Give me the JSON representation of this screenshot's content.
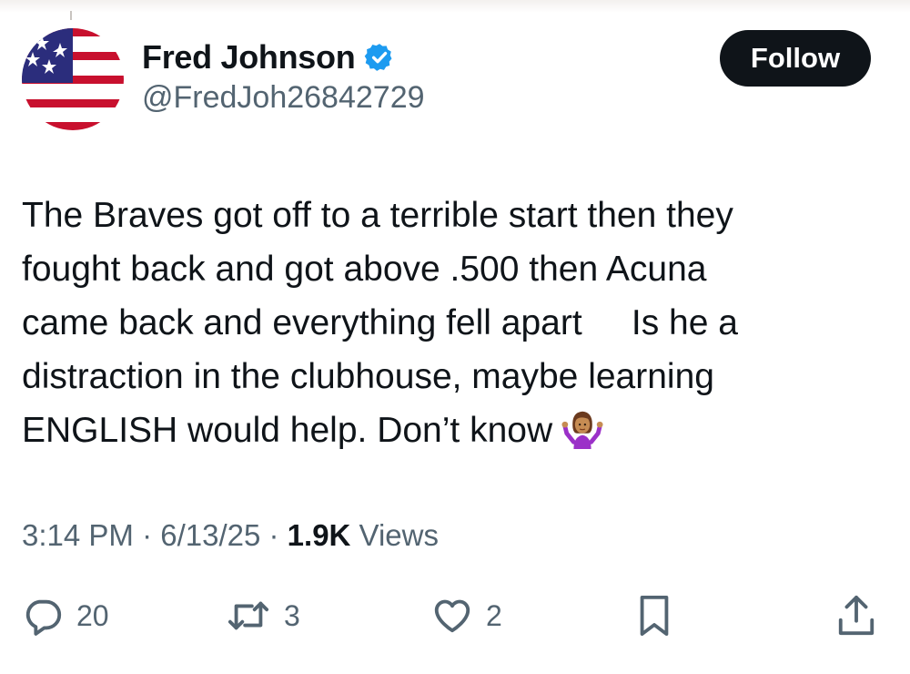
{
  "author": {
    "display_name": "Fred Johnson",
    "handle": "@FredJoh26842729",
    "verified": true,
    "avatar": "us-flag-icon"
  },
  "follow_button": {
    "label": "Follow"
  },
  "tweet": {
    "lines": [
      "The Braves got off to a terrible start then they",
      "fought back and got above .500 then Acuna",
      "came back and everything fell apart     Is he a",
      "distraction in the clubhouse, maybe learning",
      "ENGLISH would help. Don’t know"
    ],
    "emoji": "woman-shrugging-icon"
  },
  "meta": {
    "time": "3:14 PM",
    "sep1": " · ",
    "date": "6/13/25",
    "sep2": " · ",
    "views_count": "1.9K",
    "views_label": " Views"
  },
  "actions": {
    "reply": {
      "icon": "reply-icon",
      "count": "20"
    },
    "retweet": {
      "icon": "retweet-icon",
      "count": "3"
    },
    "like": {
      "icon": "heart-icon",
      "count": "2"
    },
    "bookmark": {
      "icon": "bookmark-icon"
    },
    "share": {
      "icon": "share-icon"
    }
  },
  "colors": {
    "text": "#0f1419",
    "secondary": "#536471",
    "verified_blue": "#1d9bf0",
    "button_bg": "#0f1419"
  }
}
